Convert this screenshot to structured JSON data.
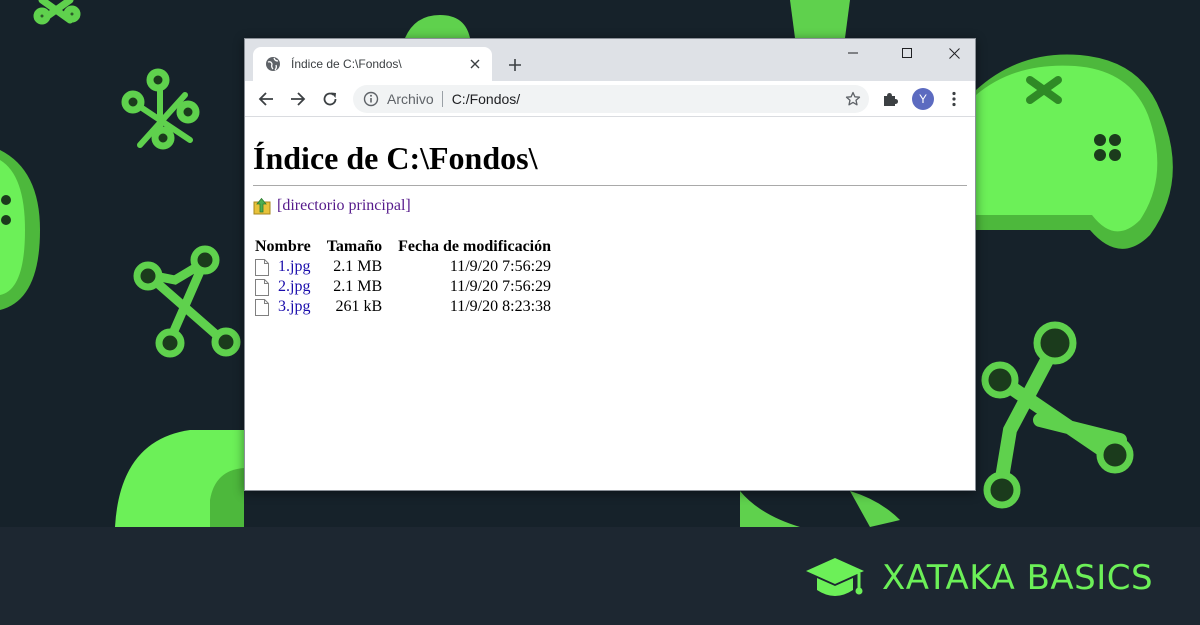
{
  "background": {
    "accent_color": "#6cf058",
    "dark_color": "#16222a"
  },
  "brand": {
    "text": "XATAKA BASICS",
    "icon": "graduation-cap-icon"
  },
  "browser": {
    "tab": {
      "title": "Índice de C:\\Fondos\\",
      "favicon": "globe-icon",
      "close_icon": "close-icon"
    },
    "new_tab_icon": "plus-icon",
    "window_controls": [
      "minimize-icon",
      "maximize-icon",
      "close-icon"
    ],
    "toolbar": {
      "nav_icons": [
        "back-arrow-icon",
        "forward-arrow-icon",
        "reload-icon"
      ],
      "address": {
        "security_label": "Archivo",
        "url": "C:/Fondos/",
        "info_icon": "info-icon",
        "star_icon": "star-icon"
      },
      "extensions_icon": "puzzle-icon",
      "avatar_letter": "Y",
      "avatar_color": "#5c6bc0",
      "menu_icon": "kebab-menu-icon"
    }
  },
  "page": {
    "title": "Índice de C:\\Fondos\\",
    "parent_link": "[directorio principal]",
    "columns": [
      "Nombre",
      "Tamaño",
      "Fecha de modificación"
    ],
    "files": [
      {
        "name": "1.jpg",
        "size": "2.1 MB",
        "modified": "11/9/20 7:56:29"
      },
      {
        "name": "2.jpg",
        "size": "2.1 MB",
        "modified": "11/9/20 7:56:29"
      },
      {
        "name": "3.jpg",
        "size": "261 kB",
        "modified": "11/9/20 8:23:38"
      }
    ]
  }
}
